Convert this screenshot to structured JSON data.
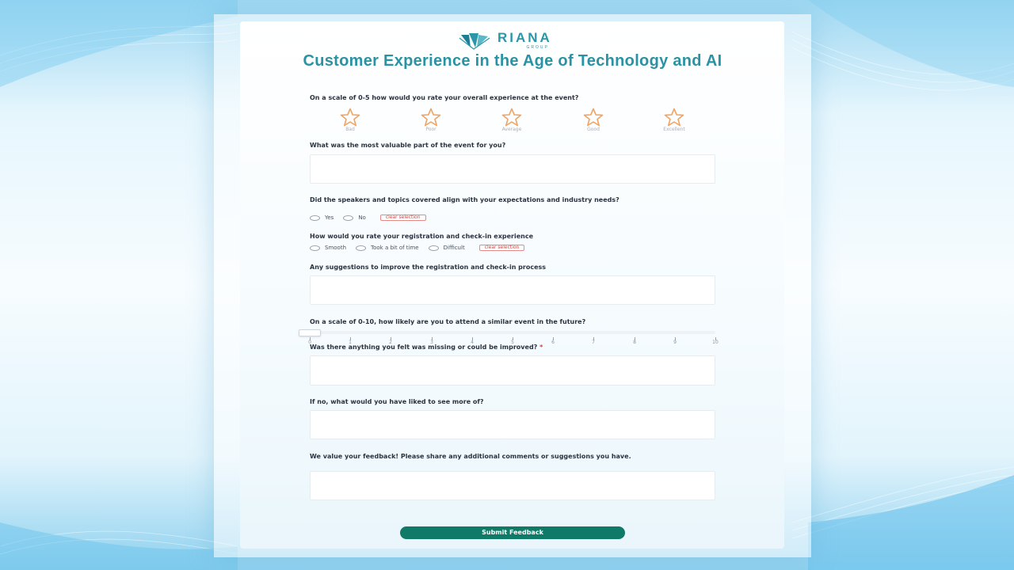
{
  "brand": {
    "name": "RIANA",
    "sub": "GROUP"
  },
  "form_title": "Customer Experience in the Age of Technology and AI",
  "rating": {
    "question": "On a scale of 0-5 how would you rate your overall experience at the event?",
    "options": [
      "Bad",
      "Poor",
      "Average",
      "Good",
      "Excellent"
    ]
  },
  "valuable": {
    "question": "What was the most valuable part of the event for you?",
    "value": ""
  },
  "speakers": {
    "question": "Did the speakers and topics covered align with your expectations and industry needs?",
    "options": [
      "Yes",
      "No"
    ],
    "clear_label": "clear selection"
  },
  "registration": {
    "question": "How would you rate your registration and check-in experience",
    "options": [
      "Smooth",
      "Took a bit of time",
      "Difficult"
    ],
    "clear_label": "clear selection"
  },
  "suggestions": {
    "question": "Any suggestions to improve the registration and check-in process",
    "value": ""
  },
  "likelihood": {
    "question": "On a scale of 0-10, how likely are you to attend a similar event in the future?",
    "ticks": [
      "0",
      "1",
      "2",
      "3",
      "4",
      "5",
      "6",
      "7",
      "8",
      "9",
      "10"
    ],
    "value": 0
  },
  "missing": {
    "question": "Was there anything you felt was missing or could be improved?",
    "required_mark": "*",
    "value": ""
  },
  "more_of": {
    "question": "If no, what would you have liked to see more of?",
    "value": ""
  },
  "feedback": {
    "question": "We value your feedback! Please share any additional comments or suggestions you have.",
    "value": ""
  },
  "submit_label": "Submit Feedback",
  "colors": {
    "accent": "#2a93a3",
    "button": "#0f7a68",
    "star": "#f0a463",
    "required": "#d9403a"
  },
  "icons": {
    "star": "star-icon",
    "logo": "riana-logo-icon"
  }
}
